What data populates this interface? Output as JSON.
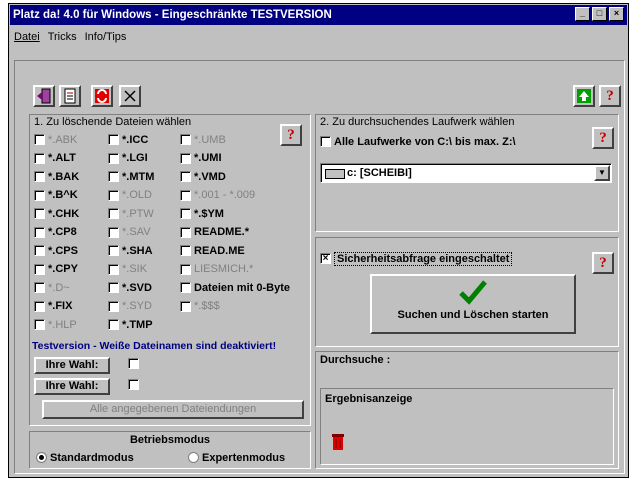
{
  "window": {
    "title": "Platz da! 4.0 für Windows - Eingeschränkte TESTVERSION"
  },
  "titlebar_buttons": [
    "_",
    "□",
    "×"
  ],
  "menu": [
    "Datei",
    "Tricks",
    "Info/Tips"
  ],
  "toolbar": {
    "icons": [
      "exit-door-icon",
      "notes-icon",
      "recycle-icon",
      "close-x-icon"
    ],
    "right_icons": [
      "update-icon",
      "help-icon"
    ]
  },
  "section1": {
    "title": "1. Zu löschende Dateien wählen",
    "col1": [
      {
        "label": "*.ABK",
        "enabled": false
      },
      {
        "label": "*.ALT",
        "enabled": true
      },
      {
        "label": "*.BAK",
        "enabled": true
      },
      {
        "label": "*.B^K",
        "enabled": true
      },
      {
        "label": "*.CHK",
        "enabled": true
      },
      {
        "label": "*.CP8",
        "enabled": true
      },
      {
        "label": "*.CPS",
        "enabled": true
      },
      {
        "label": "*.CPY",
        "enabled": true
      },
      {
        "label": "*.D~",
        "enabled": false
      },
      {
        "label": "*.FIX",
        "enabled": true
      },
      {
        "label": "*.HLP",
        "enabled": false
      }
    ],
    "col2": [
      {
        "label": "*.ICC",
        "enabled": true
      },
      {
        "label": "*.LGI",
        "enabled": true
      },
      {
        "label": "*.MTM",
        "enabled": true
      },
      {
        "label": "*.OLD",
        "enabled": false
      },
      {
        "label": "*.PTW",
        "enabled": false
      },
      {
        "label": "*.SAV",
        "enabled": false
      },
      {
        "label": "*.SHA",
        "enabled": true
      },
      {
        "label": "*.SIK",
        "enabled": false
      },
      {
        "label": "*.SVD",
        "enabled": true
      },
      {
        "label": "*.SYD",
        "enabled": false
      },
      {
        "label": "*.TMP",
        "enabled": true
      }
    ],
    "col3": [
      {
        "label": "*.UMB",
        "enabled": false
      },
      {
        "label": "*.UMI",
        "enabled": true
      },
      {
        "label": "*.VMD",
        "enabled": true
      },
      {
        "label": "*.001 - *.009",
        "enabled": false
      },
      {
        "label": "*.$YM",
        "enabled": true
      },
      {
        "label": "README.*",
        "enabled": true
      },
      {
        "label": "READ.ME",
        "enabled": true
      },
      {
        "label": "LIESMICH.*",
        "enabled": false
      },
      {
        "label": "Dateien mit 0-Byte",
        "enabled": true
      },
      {
        "label": "*.$$$",
        "enabled": false
      }
    ],
    "testversion_note": "Testversion - Weiße Dateinamen sind deaktiviert!",
    "custom_button_1": "Ihre Wahl:",
    "custom_button_2": "Ihre Wahl:",
    "all_extensions_button": "Alle angegebenen Dateiendungen"
  },
  "mode": {
    "title": "Betriebsmodus",
    "standard": "Standardmodus",
    "expert": "Expertenmodus",
    "selected": "standard"
  },
  "section2": {
    "title": "2. Zu durchsuchendes Laufwerk wählen",
    "all_drives_label": "Alle Laufwerke von C:\\ bis max. Z:\\",
    "drive_selected": "c: [SCHEIBI]"
  },
  "safety": {
    "label": "Sicherheitsabfrage eingeschaltet",
    "checked": true
  },
  "start_button": "Suchen und Löschen starten",
  "search_label": "Durchsuche :",
  "results_label": "Ergebnisanzeige"
}
